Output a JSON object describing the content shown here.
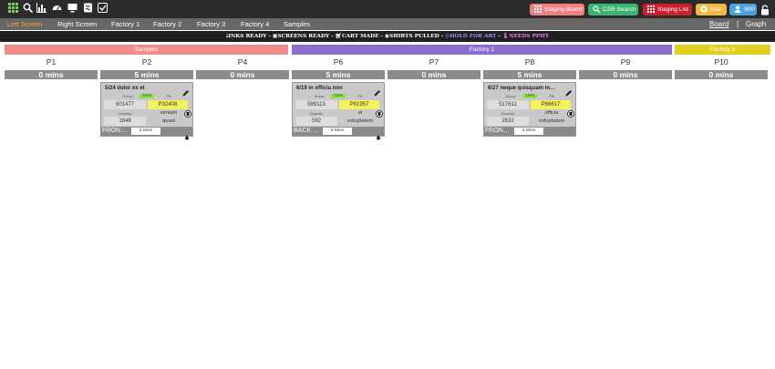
{
  "toolbar": {
    "icons": [
      "grid-icon",
      "search-icon",
      "bar-chart-icon",
      "dashboard-icon",
      "monitor-icon",
      "shirt-box-icon",
      "checklist-icon"
    ],
    "buttons": [
      {
        "label": "Staging Board",
        "icon": "grid-icon",
        "color": "#f08080"
      },
      {
        "label": "CSR Search",
        "icon": "search-icon",
        "color": "#3cb371"
      },
      {
        "label": "Staging List",
        "icon": "grid-icon",
        "color": "#cc1f2d"
      },
      {
        "label": "Nav",
        "icon": "star-icon",
        "color": "#f5b942"
      },
      {
        "label": "WIP",
        "icon": "user-icon",
        "color": "#4aa3df"
      }
    ]
  },
  "nav": {
    "items": [
      "Left Screen",
      "Right Screen",
      "Factory 1",
      "Factory 2",
      "Factory 3",
      "Factory 4",
      "Samples"
    ],
    "active": "Left Screen",
    "board": "Board",
    "separator": "|",
    "graph": "Graph"
  },
  "legend": {
    "inks": "INKS READY",
    "screens": "SCREENS READY",
    "cart": "CART MADE",
    "shirts": "SHIRTS PULLED",
    "hold": "HOLD FOR ART",
    "needs": "NEEDS PPHT",
    "sep": " - "
  },
  "groups": [
    {
      "name": "Samples",
      "color": "#f08b8b"
    },
    {
      "name": "Factory 1",
      "color": "#8a6fd0"
    },
    {
      "name": "Factory 3",
      "color": "#e0cf1e"
    }
  ],
  "columns": [
    {
      "name": "P1",
      "time": "0 mins"
    },
    {
      "name": "P2",
      "time": "5 mins"
    },
    {
      "name": "P4",
      "time": "0 mins"
    },
    {
      "name": "P6",
      "time": "5 mins"
    },
    {
      "name": "P7",
      "time": "0 mins"
    },
    {
      "name": "P8",
      "time": "5 mins"
    },
    {
      "name": "P9",
      "time": "0 mins"
    },
    {
      "name": "P10",
      "time": "0 mins"
    }
  ],
  "card_labels": {
    "group": "Group",
    "tag": "TOPS",
    "pb": "PB",
    "quantity": "Quantity"
  },
  "cards": [
    {
      "title": "5/24 dolor ex et",
      "group": "601477",
      "pb": "P32408",
      "quantity": "1848",
      "line1": "veniam",
      "line2": "quasi",
      "footer": "FRON…",
      "time": "5 Mins"
    },
    {
      "title": "6/19 in officia non",
      "group": "599113",
      "pb": "P61957",
      "quantity": "592",
      "line1": "et",
      "line2": "voluptatem",
      "footer": "BACK …",
      "time": "5 Mins"
    },
    {
      "title": "6/27 neque quisquam m…",
      "group": "517611",
      "pb": "P66617",
      "quantity": "2632",
      "line1": "officia",
      "line2": "voluptatum",
      "footer": "FRON…",
      "time": "5 Mins"
    }
  ]
}
